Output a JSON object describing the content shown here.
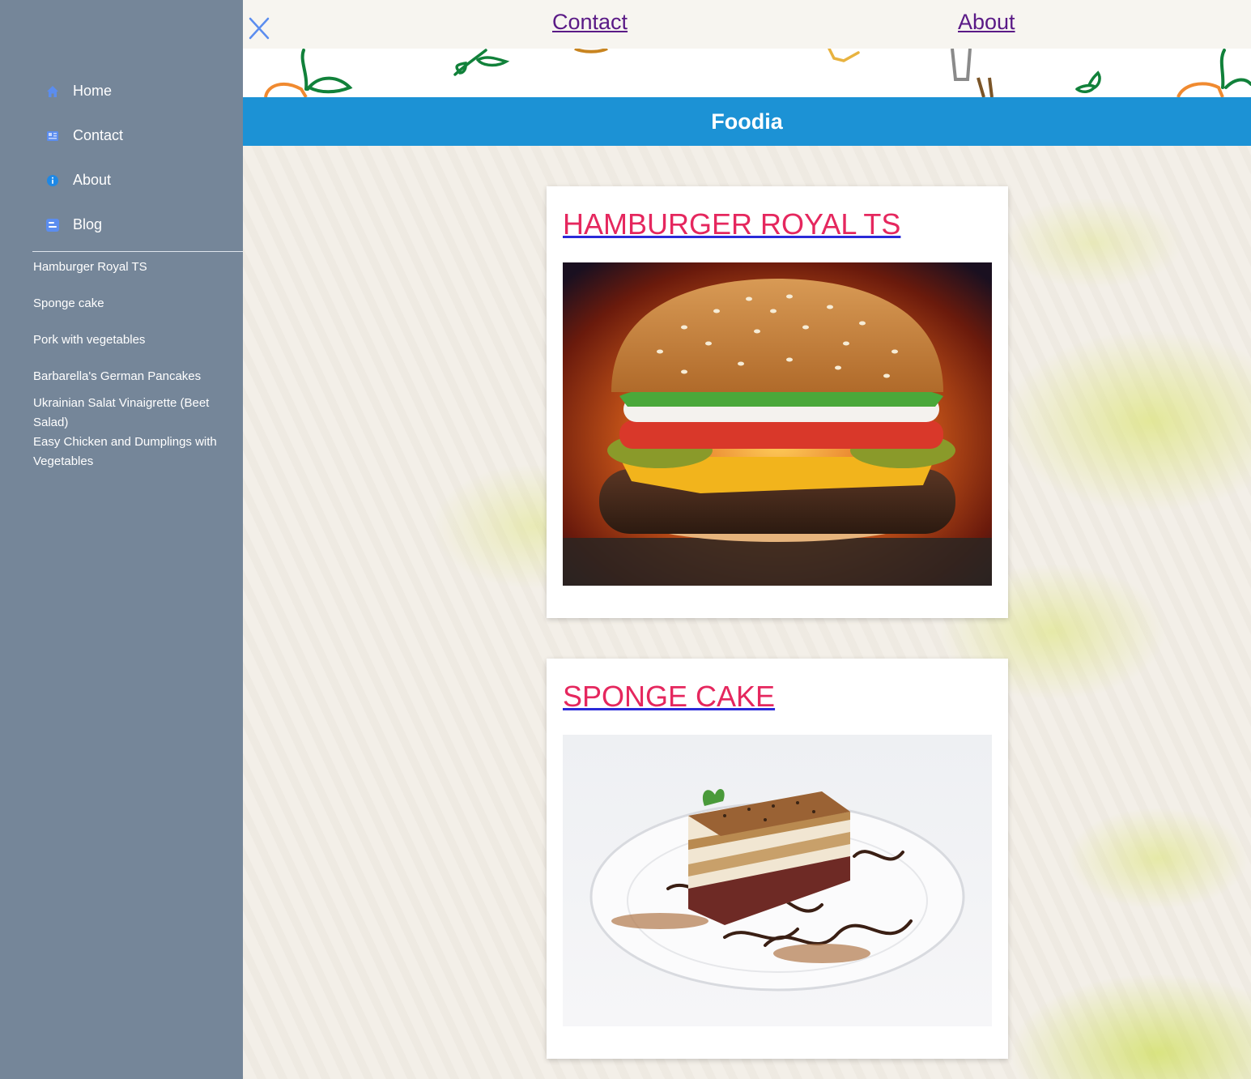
{
  "sidebar": {
    "nav": [
      {
        "label": "Home",
        "icon": "home-icon"
      },
      {
        "label": "Contact",
        "icon": "contact-card-icon"
      },
      {
        "label": "About",
        "icon": "info-icon"
      },
      {
        "label": "Blog",
        "icon": "blog-icon"
      }
    ],
    "posts": [
      "Hamburger Royal TS",
      "Sponge cake",
      "Pork with vegetables",
      "Barbarella's German Pancakes",
      "Ukrainian Salat Vinaigrette (Beet Salad)",
      "Easy Chicken and Dumplings with Vegetables"
    ]
  },
  "topbar": {
    "close_icon": "close-icon",
    "links": [
      {
        "label": "Contact"
      },
      {
        "label": "About"
      }
    ]
  },
  "brand": {
    "title": "Foodia",
    "color": "#1c92d5"
  },
  "posts": [
    {
      "title": "HAMBURGER ROYAL TS",
      "image": "hamburger-photo"
    },
    {
      "title": "SPONGE CAKE",
      "image": "sponge-cake-photo"
    }
  ],
  "colors": {
    "sidebar_bg": "#758699",
    "card_title": "#e5275e",
    "top_link": "#5a1a86",
    "icon_accent": "#5b8def"
  }
}
